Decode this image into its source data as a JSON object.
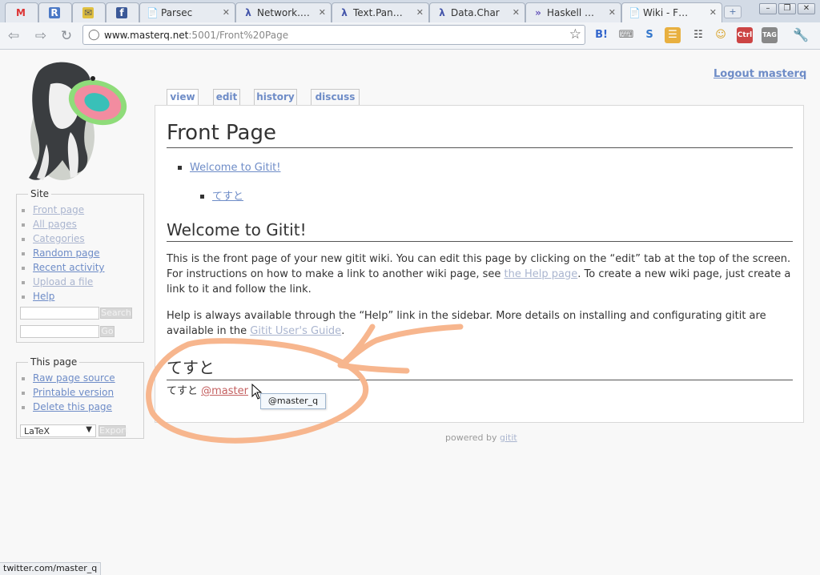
{
  "browser": {
    "tabs": [
      {
        "title": "",
        "icon": "gmail-icon",
        "pinned": true
      },
      {
        "title": "",
        "icon": "r-icon",
        "pinned": true
      },
      {
        "title": "",
        "icon": "ext-icon",
        "pinned": true
      },
      {
        "title": "",
        "icon": "facebook-icon",
        "pinned": true
      },
      {
        "title": "Parsec",
        "icon": "page-icon"
      },
      {
        "title": "Network.…",
        "icon": "lambda-icon"
      },
      {
        "title": "Text.Pan…",
        "icon": "lambda-icon"
      },
      {
        "title": "Data.Char",
        "icon": "lambda-icon"
      },
      {
        "title": "Haskell …",
        "icon": "haskell-icon"
      },
      {
        "title": "Wiki - F…",
        "icon": "page-icon",
        "active": true
      }
    ],
    "url_host": "www.masterq.net",
    "url_rest": ":5001/Front%20Page"
  },
  "page": {
    "logout": "Logout masterq",
    "tabs": [
      "view",
      "edit",
      "history",
      "discuss"
    ],
    "site": {
      "legend": "Site",
      "items": [
        "Front page",
        "All pages",
        "Categories",
        "Random page",
        "Recent activity",
        "Upload a file",
        "Help"
      ],
      "search_button": "Search",
      "go_button": "Go"
    },
    "this_page": {
      "legend": "This page",
      "items": [
        "Raw page source",
        "Printable version",
        "Delete this page"
      ],
      "format": "LaTeX",
      "export_button": "Export"
    },
    "title": "Front Page",
    "toc": {
      "item1": "Welcome to Gitit!",
      "item2": "てすと"
    },
    "h2_welcome": "Welcome to Gitit!",
    "p1_a": "This is the front page of your new gitit wiki. You can edit this page by clicking on the “edit” tab at the top of the screen. For instructions on how to make a link to another wiki page, see ",
    "p1_link": "the Help page",
    "p1_b": ". To create a new wiki page, just create a link to it and follow the link.",
    "p2_a": "Help is always available through the “Help” link in the sidebar. More details on installing and configurating gitit are available in the ",
    "p2_link": "Gitit User's Guide",
    "p2_b": ".",
    "h2_tesuto": "てすと",
    "p3_text": "てすと ",
    "p3_link": "@master",
    "tooltip": "@master_q",
    "powered_by": "powered by ",
    "powered_link": "gitit"
  },
  "status_bar": "twitter.com/master_q"
}
